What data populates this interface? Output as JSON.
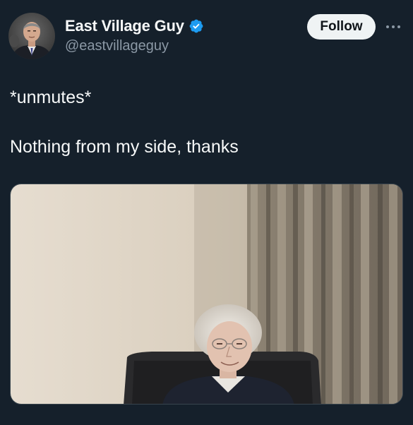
{
  "author": {
    "display_name": "East Village Guy",
    "handle": "@eastvillageguy",
    "verified": true,
    "avatar_icon": "profile-photo-man-in-suit"
  },
  "actions": {
    "follow_label": "Follow",
    "more_icon": "more-horizontal-icon"
  },
  "tweet": {
    "lines": [
      "*unmutes*",
      "Nothing from my side, thanks"
    ]
  },
  "media": {
    "type": "video-call-still",
    "description_icon": "man-on-video-call-photo"
  },
  "colors": {
    "background": "#15202b",
    "text_primary": "#f7f9f9",
    "text_secondary": "#8b98a5",
    "verified_blue": "#1d9bf0",
    "button_bg": "#eff3f4",
    "button_text": "#0f1419"
  }
}
